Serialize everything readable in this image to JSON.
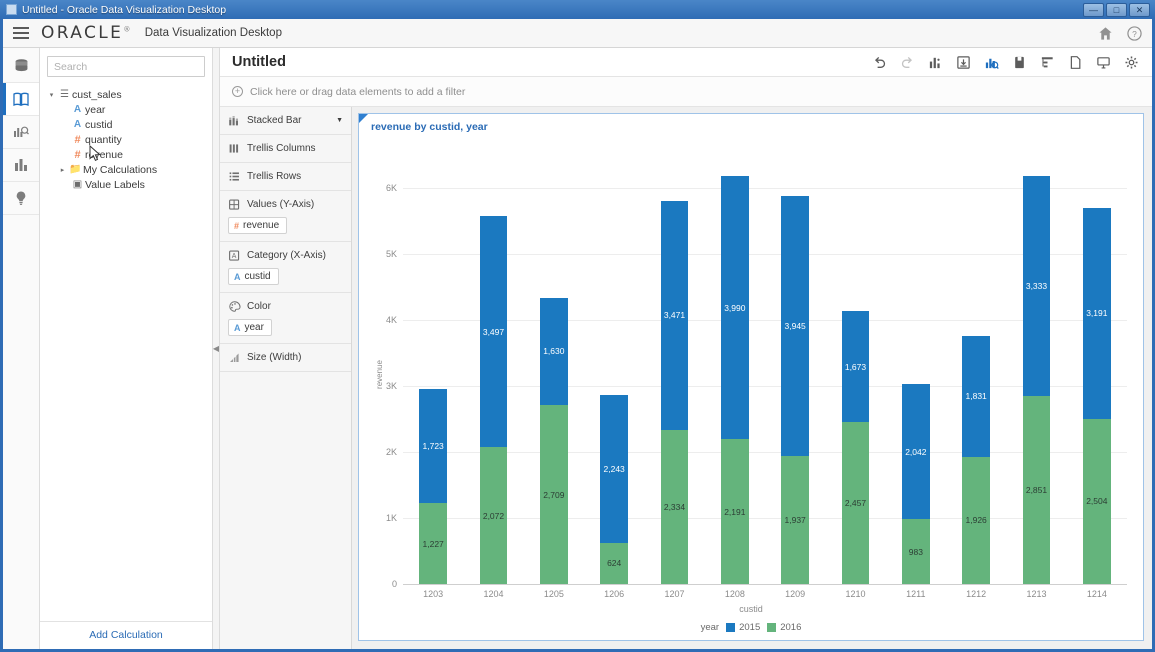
{
  "window": {
    "title": "Untitled - Oracle Data Visualization Desktop",
    "minimize_label": "—",
    "maximize_label": "□",
    "close_label": "✕"
  },
  "header": {
    "menu_label": "menu",
    "logo": "ORACLE",
    "registered_mark": "®",
    "product": "Data Visualization Desktop",
    "icons": [
      {
        "name": "home-icon",
        "glyph": "⌂"
      },
      {
        "name": "help-icon",
        "glyph": "?"
      }
    ]
  },
  "icon_rail": [
    {
      "name": "data-sources-icon",
      "label": "Data"
    },
    {
      "name": "projects-icon",
      "label": "Projects",
      "active": true
    },
    {
      "name": "data-flows-icon",
      "label": "Data Flows"
    },
    {
      "name": "visualizations-icon",
      "label": "Visualizations"
    },
    {
      "name": "insights-icon",
      "label": "Insights"
    }
  ],
  "data_panel": {
    "search": {
      "placeholder": "Search",
      "value": ""
    },
    "tree": [
      {
        "label": "cust_sales",
        "type": "table",
        "level": 0,
        "expanded": true,
        "icon": "table-icon"
      },
      {
        "label": "year",
        "type": "attribute",
        "level": 1,
        "icon": "attribute-icon"
      },
      {
        "label": "custid",
        "type": "attribute",
        "level": 1,
        "icon": "attribute-icon"
      },
      {
        "label": "quantity",
        "type": "measure",
        "level": 1,
        "icon": "measure-icon"
      },
      {
        "label": "revenue",
        "type": "measure",
        "level": 1,
        "icon": "measure-icon",
        "hovered": true
      },
      {
        "label": "My Calculations",
        "type": "folder",
        "level": 0,
        "expanded": false,
        "icon": "folder-icon"
      },
      {
        "label": "Value Labels",
        "type": "badge",
        "level": 0,
        "icon": "value-labels-icon"
      }
    ],
    "add_calculation": "Add Calculation"
  },
  "canvas": {
    "page_title": "Untitled",
    "toolbar": [
      {
        "name": "undo-button",
        "label": "Undo",
        "state": "enabled"
      },
      {
        "name": "redo-button",
        "label": "Redo",
        "state": "disabled"
      },
      {
        "name": "visualization-button",
        "label": "Visualization",
        "state": "enabled"
      },
      {
        "name": "save-button",
        "label": "Save",
        "state": "enabled"
      },
      {
        "name": "insights-button",
        "label": "Insights",
        "state": "active"
      },
      {
        "name": "story-button",
        "label": "Story",
        "state": "enabled"
      },
      {
        "name": "data-diagram-button",
        "label": "Data Diagram",
        "state": "enabled"
      },
      {
        "name": "new-canvas-button",
        "label": "New Canvas",
        "state": "enabled"
      },
      {
        "name": "presentation-button",
        "label": "Presentation",
        "state": "enabled"
      },
      {
        "name": "settings-button",
        "label": "Settings",
        "state": "enabled"
      }
    ],
    "filter_bar": {
      "placeholder": "Click here or drag data elements to add a filter",
      "add_icon": "plus-circle-icon"
    }
  },
  "grammar_panel": {
    "viz_type": {
      "label": "Stacked Bar",
      "icon": "stacked-bar-icon",
      "caret": "▼"
    },
    "sections": [
      {
        "name": "trellis-columns",
        "label": "Trellis Columns",
        "icon": "trellis-columns-icon",
        "pills": []
      },
      {
        "name": "trellis-rows",
        "label": "Trellis Rows",
        "icon": "trellis-rows-icon",
        "pills": []
      },
      {
        "name": "values-y-axis",
        "label": "Values (Y-Axis)",
        "icon": "values-icon",
        "pills": [
          {
            "label": "revenue",
            "kind": "measure"
          }
        ]
      },
      {
        "name": "category-x-axis",
        "label": "Category (X-Axis)",
        "icon": "category-icon",
        "pills": [
          {
            "label": "custid",
            "kind": "attribute"
          }
        ]
      },
      {
        "name": "color",
        "label": "Color",
        "icon": "palette-icon",
        "pills": [
          {
            "label": "year",
            "kind": "attribute"
          }
        ]
      },
      {
        "name": "size-width",
        "label": "Size (Width)",
        "icon": "size-icon",
        "pills": []
      }
    ]
  },
  "chart_data": {
    "type": "bar",
    "subtype": "stacked",
    "title": "revenue by custid, year",
    "xlabel": "custid",
    "ylabel": "revenue",
    "ylim": [
      0,
      6500
    ],
    "yticks": [
      0,
      1000,
      2000,
      3000,
      4000,
      5000,
      6000
    ],
    "ytick_labels": [
      "0",
      "1K",
      "2K",
      "3K",
      "4K",
      "5K",
      "6K"
    ],
    "grid": true,
    "legend_position": "bottom",
    "legend_title": "year",
    "categories": [
      "1203",
      "1204",
      "1205",
      "1206",
      "1207",
      "1208",
      "1209",
      "1210",
      "1211",
      "1212",
      "1213",
      "1214"
    ],
    "series": [
      {
        "name": "2016",
        "color": "#64b47c",
        "values": [
          1227,
          2072,
          2709,
          624,
          2334,
          2191,
          1937,
          2457,
          983,
          1926,
          2851,
          2504
        ],
        "labels": [
          "1,227",
          "2,072",
          "2,709",
          "624",
          "2,334",
          "2,191",
          "1,937",
          "2,457",
          "983",
          "1,926",
          "2,851",
          "2,504"
        ]
      },
      {
        "name": "2015",
        "color": "#1b79c0",
        "values": [
          1723,
          3497,
          1630,
          2243,
          3471,
          3990,
          3945,
          1673,
          2042,
          1831,
          3333,
          3191
        ],
        "labels": [
          "1,723",
          "3,497",
          "1,630",
          "2,243",
          "3,471",
          "3,990",
          "3,945",
          "1,673",
          "2,042",
          "1,831",
          "3,333",
          "3,191"
        ]
      }
    ]
  }
}
